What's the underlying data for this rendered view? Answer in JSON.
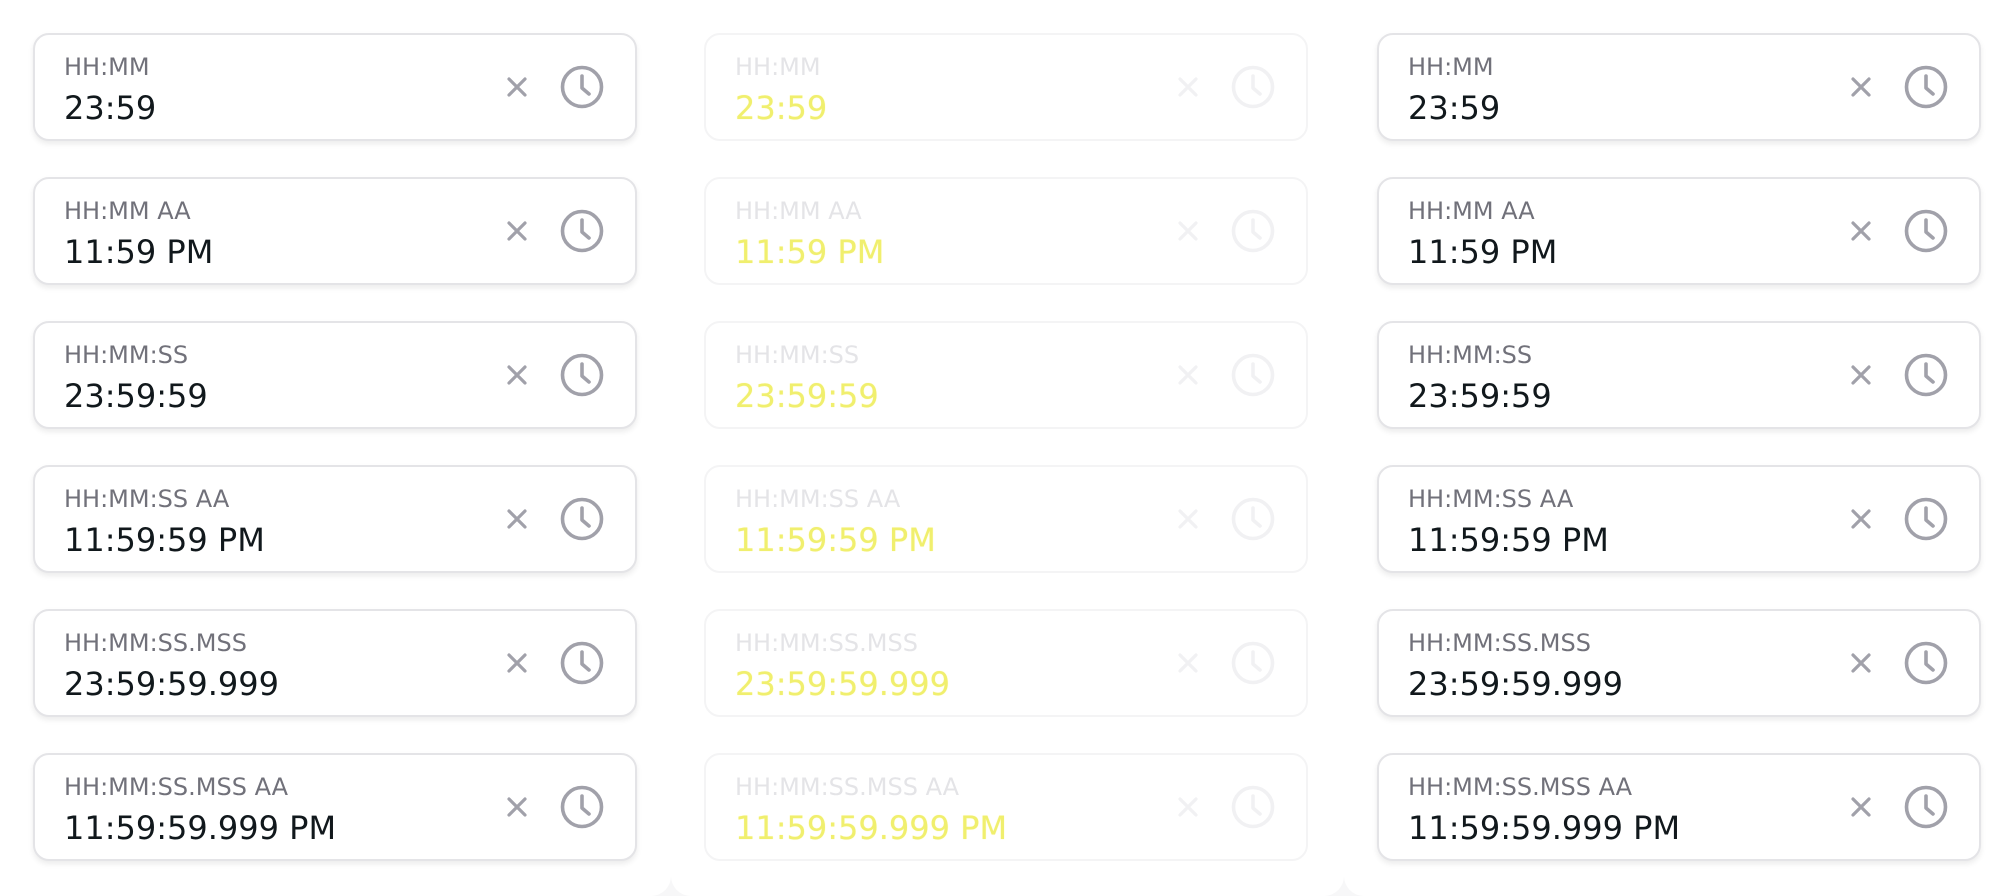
{
  "colors": {
    "label": "#71717a",
    "value": "#11181c",
    "icon": "#a1a1aa",
    "border": "#e4e4e7",
    "disabled_value": "#f0ef6e"
  },
  "columns": [
    {
      "state": "enabled",
      "fields": [
        {
          "label": "HH:MM",
          "value": "23:59",
          "icons": [
            "close-icon",
            "clock-icon"
          ]
        },
        {
          "label": "HH:MM AA",
          "value": "11:59 PM",
          "icons": [
            "close-icon",
            "clock-icon"
          ]
        },
        {
          "label": "HH:MM:SS",
          "value": "23:59:59",
          "icons": [
            "close-icon",
            "clock-icon"
          ]
        },
        {
          "label": "HH:MM:SS AA",
          "value": "11:59:59 PM",
          "icons": [
            "close-icon",
            "clock-icon"
          ]
        },
        {
          "label": "HH:MM:SS.MSS",
          "value": "23:59:59.999",
          "icons": [
            "close-icon",
            "clock-icon"
          ]
        },
        {
          "label": "HH:MM:SS.MSS AA",
          "value": "11:59:59.999 PM",
          "icons": [
            "close-icon",
            "clock-icon"
          ]
        }
      ]
    },
    {
      "state": "disabled",
      "fields": [
        {
          "label": "HH:MM",
          "value": "23:59",
          "icons": [
            "close-icon",
            "clock-icon"
          ]
        },
        {
          "label": "HH:MM AA",
          "value": "11:59 PM",
          "icons": [
            "close-icon",
            "clock-icon"
          ]
        },
        {
          "label": "HH:MM:SS",
          "value": "23:59:59",
          "icons": [
            "close-icon",
            "clock-icon"
          ]
        },
        {
          "label": "HH:MM:SS AA",
          "value": "11:59:59 PM",
          "icons": [
            "close-icon",
            "clock-icon"
          ]
        },
        {
          "label": "HH:MM:SS.MSS",
          "value": "23:59:59.999",
          "icons": [
            "close-icon",
            "clock-icon"
          ]
        },
        {
          "label": "HH:MM:SS.MSS AA",
          "value": "11:59:59.999 PM",
          "icons": [
            "close-icon",
            "clock-icon"
          ]
        }
      ]
    },
    {
      "state": "enabled",
      "fields": [
        {
          "label": "HH:MM",
          "value": "23:59",
          "icons": [
            "close-icon",
            "clock-icon"
          ]
        },
        {
          "label": "HH:MM AA",
          "value": "11:59 PM",
          "icons": [
            "close-icon",
            "clock-icon"
          ]
        },
        {
          "label": "HH:MM:SS",
          "value": "23:59:59",
          "icons": [
            "close-icon",
            "clock-icon"
          ]
        },
        {
          "label": "HH:MM:SS AA",
          "value": "11:59:59 PM",
          "icons": [
            "close-icon",
            "clock-icon"
          ]
        },
        {
          "label": "HH:MM:SS.MSS",
          "value": "23:59:59.999",
          "icons": [
            "close-icon",
            "clock-icon"
          ]
        },
        {
          "label": "HH:MM:SS.MSS AA",
          "value": "11:59:59.999 PM",
          "icons": [
            "close-icon",
            "clock-icon"
          ]
        }
      ]
    }
  ]
}
